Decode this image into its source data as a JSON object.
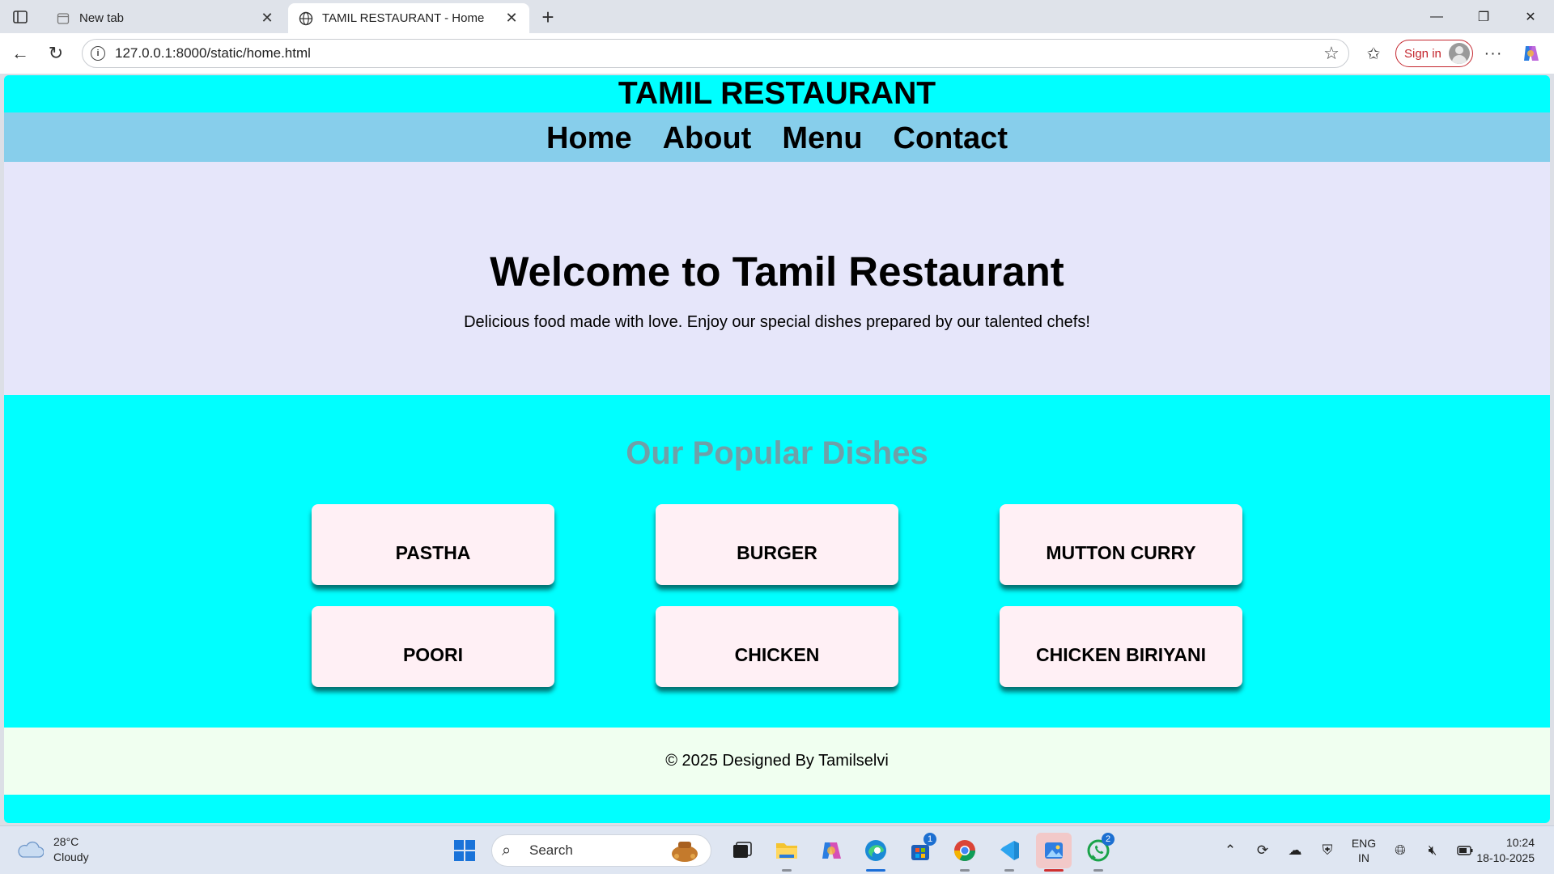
{
  "browser": {
    "tabs": [
      {
        "title": "New tab",
        "active": false
      },
      {
        "title": "TAMIL RESTAURANT - Home",
        "active": true
      }
    ],
    "url": "127.0.0.1:8000/static/home.html",
    "signin_label": "Sign in",
    "icons": [
      "sidebar-icon",
      "back-icon",
      "reload-icon",
      "info-icon",
      "star-icon",
      "favorites-icon",
      "more-icon",
      "copilot-icon"
    ]
  },
  "site": {
    "title": "TAMIL RESTAURANT",
    "nav": [
      "Home",
      "About",
      "Menu",
      "Contact"
    ],
    "hero": {
      "heading": "Welcome to Tamil Restaurant",
      "text": "Delicious food made with love. Enjoy our special dishes prepared by our talented chefs!"
    },
    "dishes": {
      "heading": "Our Popular Dishes",
      "items": [
        "PASTHA",
        "BURGER",
        "MUTTON CURRY",
        "POORI",
        "CHICKEN",
        "CHICKEN BIRIYANI"
      ]
    },
    "footer": "© 2025 Designed By Tamilselvi",
    "colors": {
      "header": "#00ffff",
      "nav": "#87ceeb",
      "hero": "#e6e6fa",
      "dishes_heading": "#6fa0a8",
      "card": "#fff0f5",
      "footer": "#f0fff0"
    }
  },
  "taskbar": {
    "weather": {
      "temp": "28°C",
      "condition": "Cloudy"
    },
    "search_label": "Search",
    "badges": {
      "store": "1",
      "whatsapp": "2"
    },
    "lang": {
      "line1": "ENG",
      "line2": "IN"
    },
    "time": "10:24",
    "date": "18-10-2025"
  }
}
